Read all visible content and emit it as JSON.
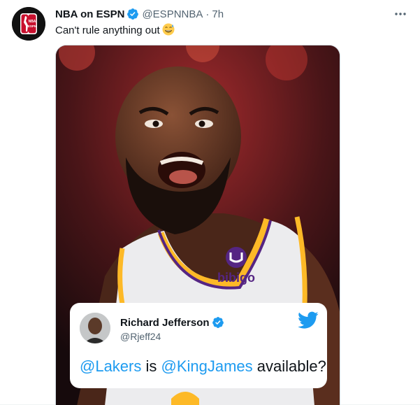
{
  "tweet": {
    "display_name": "NBA on ESPN",
    "handle": "@ESPNNBA",
    "separator": "·",
    "time": "7h",
    "text": "Can't rule anything out",
    "emoji": "sweat-smile-emoji",
    "avatar_logo_text": [
      "NBA",
      "ESPN"
    ]
  },
  "media": {
    "jersey_sponsor": "bibigo",
    "quoted_tweet": {
      "name": "Richard Jefferson",
      "handle": "@Rjeff24",
      "text_parts": [
        {
          "text": "@Lakers",
          "type": "mention"
        },
        {
          "text": " is ",
          "type": "plain"
        },
        {
          "text": "@KingJames",
          "type": "mention"
        },
        {
          "text": " available?",
          "type": "plain"
        }
      ]
    }
  },
  "colors": {
    "accent": "#1d9bf0",
    "verified": "#1d9bf0",
    "secondary_text": "#536471",
    "lakers_gold": "#fdb927",
    "lakers_purple": "#552583"
  },
  "icons": [
    "verified-badge-icon",
    "more-options-icon",
    "twitter-bird-icon"
  ]
}
